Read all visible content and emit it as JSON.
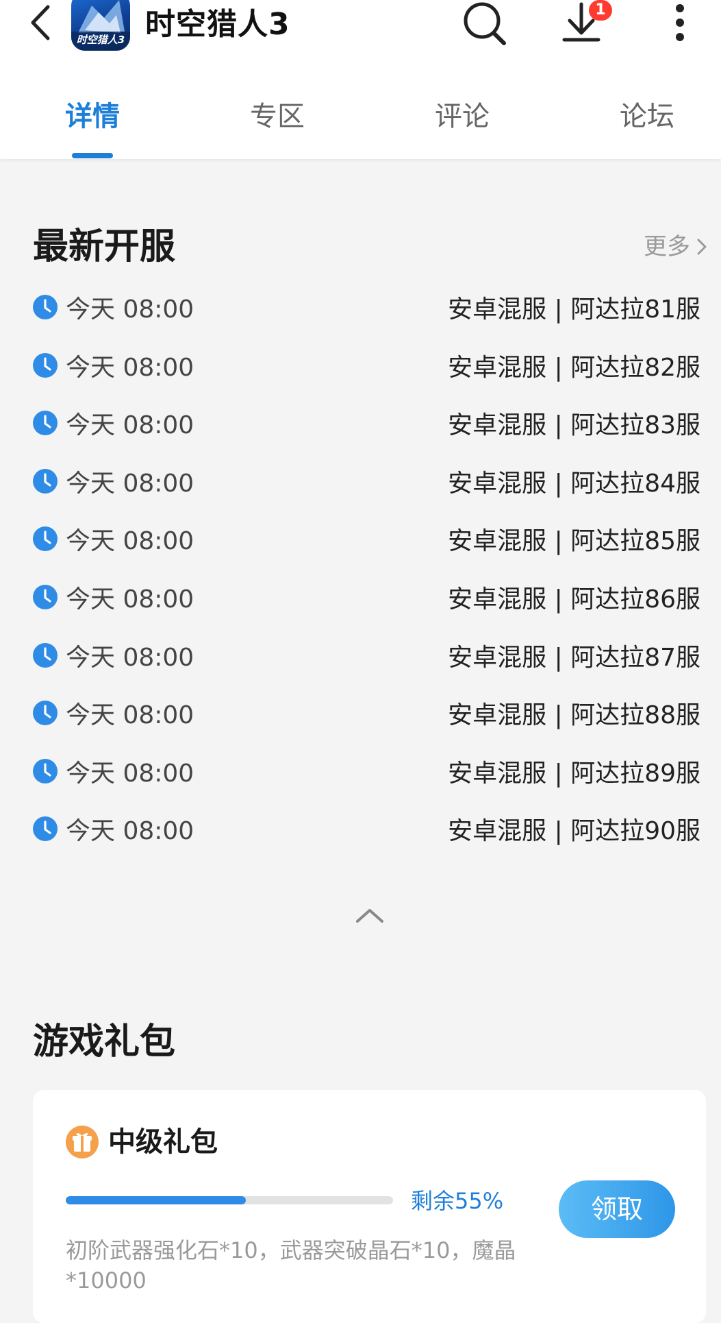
{
  "header": {
    "app_title": "时空猎人3",
    "app_icon_text": "时空猎人3",
    "download_badge": "1",
    "icons": [
      "back-arrow-icon",
      "search-icon",
      "download-icon",
      "more-vertical-icon"
    ]
  },
  "tabs": [
    {
      "label": "详情",
      "active": true
    },
    {
      "label": "专区",
      "active": false
    },
    {
      "label": "评论",
      "active": false
    },
    {
      "label": "论坛",
      "active": false
    }
  ],
  "servers": {
    "title": "最新开服",
    "more_label": "更多",
    "items": [
      {
        "time": "今天 08:00",
        "name": "安卓混服 | 阿达拉81服"
      },
      {
        "time": "今天 08:00",
        "name": "安卓混服 | 阿达拉82服"
      },
      {
        "time": "今天 08:00",
        "name": "安卓混服 | 阿达拉83服"
      },
      {
        "time": "今天 08:00",
        "name": "安卓混服 | 阿达拉84服"
      },
      {
        "time": "今天 08:00",
        "name": "安卓混服 | 阿达拉85服"
      },
      {
        "time": "今天 08:00",
        "name": "安卓混服 | 阿达拉86服"
      },
      {
        "time": "今天 08:00",
        "name": "安卓混服 | 阿达拉87服"
      },
      {
        "time": "今天 08:00",
        "name": "安卓混服 | 阿达拉88服"
      },
      {
        "time": "今天 08:00",
        "name": "安卓混服 | 阿达拉89服"
      },
      {
        "time": "今天 08:00",
        "name": "安卓混服 | 阿达拉90服"
      }
    ]
  },
  "gifts": {
    "title": "游戏礼包",
    "items": [
      {
        "name": "中级礼包",
        "remaining_fraction": 0.55,
        "remaining_label": "剩余55%",
        "claim_label": "领取",
        "description": "初阶武器强化石*10，武器突破晶石*10，魔晶*10000"
      }
    ]
  },
  "colors": {
    "accent": "#1e7fd8",
    "badge": "#ff3b30",
    "gift_icon": "#f5a04a"
  }
}
